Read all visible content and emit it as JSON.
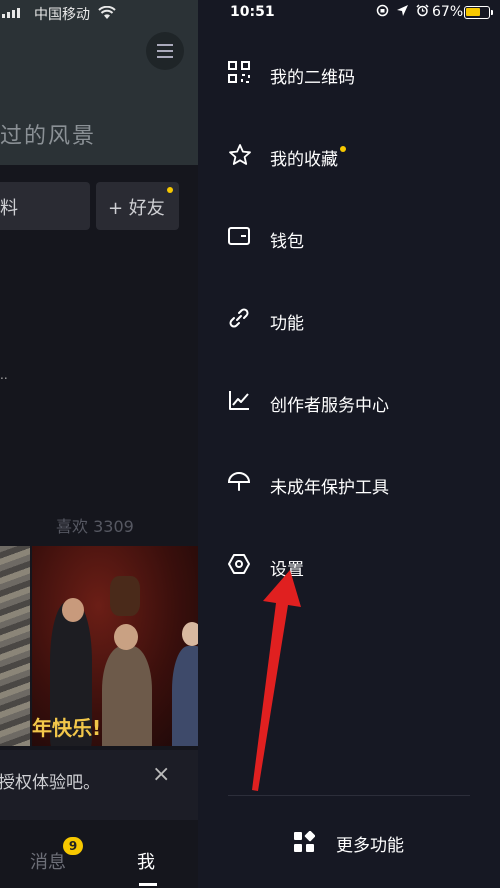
{
  "status_left": {
    "carrier": "中国移动"
  },
  "status_right": {
    "time": "10:51",
    "battery": "67%",
    "battery_level": 0.67
  },
  "profile": {
    "cover_text": "过的风景",
    "edit_button": "料",
    "add_friend_button": "+ 好友",
    "ellipsis": "..",
    "likes": "喜欢 3309",
    "video_caption": "年快乐!",
    "auth_prompt": "授权体验吧。",
    "close": "×"
  },
  "tabbar": {
    "messages": "消息",
    "messages_badge": "9",
    "me": "我"
  },
  "drawer": {
    "items": [
      {
        "label": "我的二维码",
        "icon": "qrcode-icon"
      },
      {
        "label": "我的收藏",
        "icon": "star-icon"
      },
      {
        "label": "钱包",
        "icon": "wallet-icon"
      },
      {
        "label": "功能",
        "icon": "link-icon"
      },
      {
        "label": "创作者服务中心",
        "icon": "chart-icon"
      },
      {
        "label": "未成年保护工具",
        "icon": "umbrella-icon"
      },
      {
        "label": "设置",
        "icon": "hexagon-settings-icon"
      }
    ],
    "more": "更多功能"
  },
  "colors": {
    "accent": "#f7c800",
    "drawer_bg": "#161823",
    "arrow": "#e02020"
  }
}
